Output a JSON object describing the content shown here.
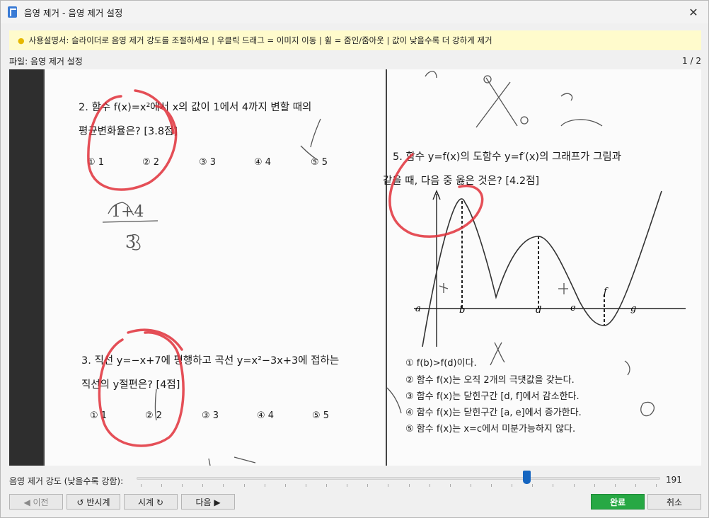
{
  "window": {
    "title": "음영 제거 - 음영 제거 설정",
    "close_glyph": "✕"
  },
  "tip": {
    "text": "사용설명서: 슬라이더로 음영 제거 강도를 조절하세요 | 우클릭 드래그 = 이미지 이동 | 휠 = 줌인/줌아웃 | 값이 낮을수록 더 강하게 제거"
  },
  "file": {
    "label": "파일: 음영 제거 설정",
    "page_indicator": "1 / 2"
  },
  "document": {
    "q2_line1": "2. 함수 f(x)=x²에서 x의 값이 1에서 4까지 변할 때의",
    "q2_line2": "평균변화율은? [3.8점]",
    "q2_options": [
      "① 1",
      "② 2",
      "③ 3",
      "④ 4",
      "⑤ 5"
    ],
    "q3_line1": "3. 직선 y=−x+7에 평행하고 곡선 y=x²−3x+3에 접하는",
    "q3_line2": "직선의 y절편은? [4점]",
    "q3_options": [
      "① 1",
      "② 2",
      "③ 3",
      "④ 4",
      "⑤ 5"
    ],
    "q5_line1": "5. 함수 y=f(x)의 도함수 y=f′(x)의 그래프가 그림과",
    "q5_line2": "같을 때, 다음 중 옳은 것은? [4.2점]",
    "q5_options": [
      "① f(b)>f(d)이다.",
      "② 함수 f(x)는 오직 2개의 극댓값을 갖는다.",
      "③ 함수 f(x)는 닫힌구간 [d, f]에서 감소한다.",
      "④ 함수 f(x)는 닫힌구간 [a, e]에서 증가한다.",
      "⑤ 함수 f(x)는 x=c에서 미분가능하지 않다."
    ],
    "graph_labels": {
      "a": "a",
      "b": "b",
      "d": "d",
      "e": "e",
      "f": "f",
      "g": "g"
    },
    "handwriting_fraction_top": "1+4",
    "handwriting_fraction_bottom": "3"
  },
  "slider": {
    "label": "음영 제거 강도 (낮을수록 강함):",
    "value": 191,
    "min": 0,
    "max": 255,
    "tick_count": 26
  },
  "buttons": {
    "prev": "◀ 이전",
    "rotate_ccw": "↺ 반시계",
    "rotate_cw": "시계 ↻",
    "next": "다음 ▶",
    "done": "완료",
    "cancel": "취소"
  },
  "colors": {
    "done_button": "#27a844",
    "slider_thumb": "#1565c0",
    "tip_background": "#fffbcc",
    "pen_red": "#e0303a"
  }
}
